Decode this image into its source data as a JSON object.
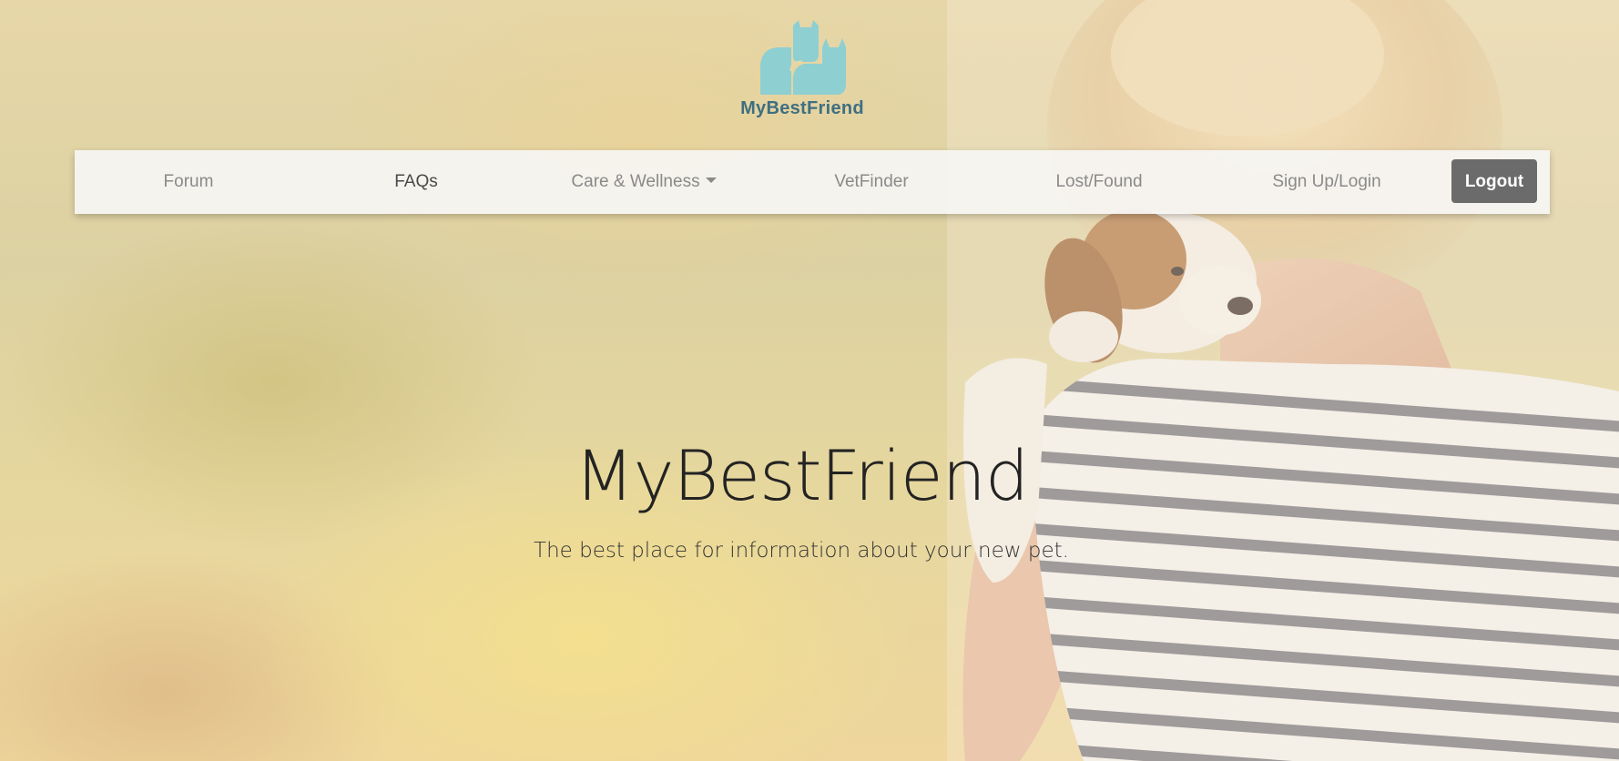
{
  "logo": {
    "text": "MyBestFriend",
    "icon": "two-cats-logo-icon",
    "color": "#8ecfd2"
  },
  "nav": {
    "items": [
      {
        "label": "Forum",
        "active": false
      },
      {
        "label": "FAQs",
        "active": true
      },
      {
        "label": "Care & Wellness",
        "active": false,
        "dropdown": true
      },
      {
        "label": "VetFinder",
        "active": false
      },
      {
        "label": "Lost/Found",
        "active": false
      },
      {
        "label": "Sign Up/Login",
        "active": false
      }
    ],
    "logout_label": "Logout"
  },
  "hero": {
    "title": "MyBestFriend",
    "subtitle": "The best place for information about your new pet."
  },
  "colors": {
    "accent": "#8ecfd2",
    "logo_text": "#3f6f82",
    "logout_bg": "#6b6b6b"
  }
}
